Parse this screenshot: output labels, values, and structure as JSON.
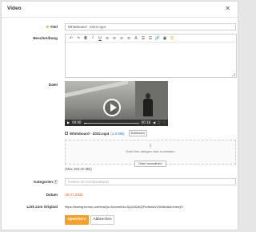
{
  "dialog": {
    "title": "Video",
    "close_glyph": "✕"
  },
  "form": {
    "title_label": "Titel",
    "title_value": "Whiteboard - 2022.mp4",
    "description_label": "Beschreibung",
    "file_label": "Datei",
    "category_label": "Kategorien",
    "category_placeholder": "Kreiere ein Schlüsselwort",
    "date_label": "Datum",
    "date_value": "19.07.2021",
    "link_label": "Link zum Original",
    "link_value": "https://testing.formis.com/test/[u=3/home04s-5[1115260]/PortfolioV2/0/MediaCenter]/0"
  },
  "toolbar": {
    "buttons": [
      {
        "name": "undo-icon",
        "glyph": "↶"
      },
      {
        "name": "redo-icon",
        "glyph": "↷"
      },
      {
        "name": "bold-button",
        "glyph": "B",
        "cls": "b"
      },
      {
        "name": "italic-button",
        "glyph": "I",
        "cls": "i"
      },
      {
        "name": "underline-button",
        "glyph": "U",
        "cls": "u"
      },
      {
        "name": "align-left-icon",
        "glyph": "≡"
      },
      {
        "name": "align-center-icon",
        "glyph": "≡"
      },
      {
        "name": "align-right-icon",
        "glyph": "≡"
      },
      {
        "name": "align-justify-icon",
        "glyph": "≡"
      },
      {
        "name": "text-color-icon",
        "glyph": "A"
      },
      {
        "name": "numbered-list-icon",
        "glyph": "☰"
      },
      {
        "name": "bulleted-list-icon",
        "glyph": "☰"
      },
      {
        "name": "link-icon",
        "glyph": "🔗"
      },
      {
        "name": "image-icon",
        "glyph": "▣"
      },
      {
        "name": "emoji-icon",
        "glyph": "☺",
        "cls": "emoji"
      }
    ]
  },
  "video": {
    "time_current": "00:00",
    "time_total": "00:18",
    "progress": 0.05
  },
  "file": {
    "name": "Whiteboard - 2022.mp4",
    "size": "(1,5 MB)",
    "remove_label": "Entfernen"
  },
  "upload": {
    "hint": "Datei hier ablegen oder hochladen",
    "choose_label": "Datei auswählen",
    "max_size": "(Max 250,00 MB)"
  },
  "actions": {
    "save_label": "Speichern",
    "cancel_label": "Abbrechen"
  },
  "colors": {
    "accent": "#f2a12e",
    "date": "#e05a1e",
    "required_star": "#f0a020"
  }
}
